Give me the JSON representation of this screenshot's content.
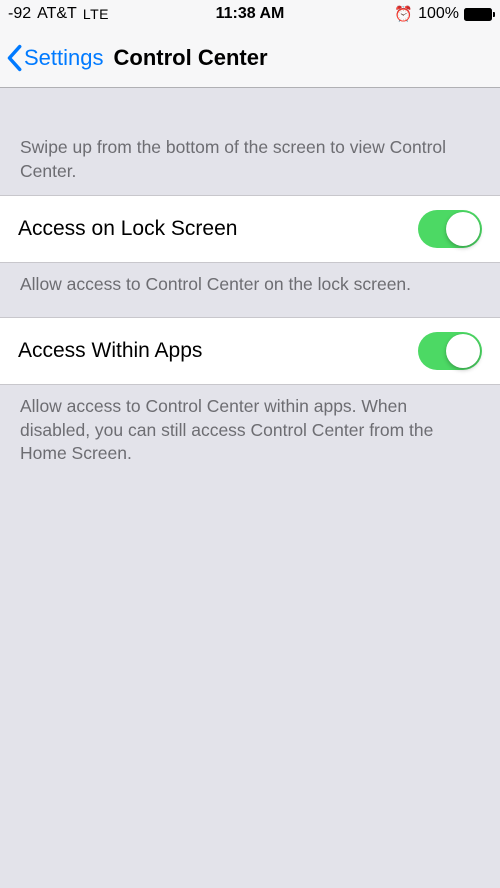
{
  "status_bar": {
    "signal": "-92",
    "carrier": "AT&T",
    "network": "LTE",
    "time": "11:38 AM",
    "battery_percent": "100%"
  },
  "nav": {
    "back_label": "Settings",
    "title": "Control Center"
  },
  "intro_text": "Swipe up from the bottom of the screen to view Control Center.",
  "settings": [
    {
      "label": "Access on Lock Screen",
      "enabled": true,
      "footer": "Allow access to Control Center on the lock screen."
    },
    {
      "label": "Access Within Apps",
      "enabled": true,
      "footer": "Allow access to Control Center within apps. When disabled, you can still access Control Center from the Home Screen."
    }
  ]
}
